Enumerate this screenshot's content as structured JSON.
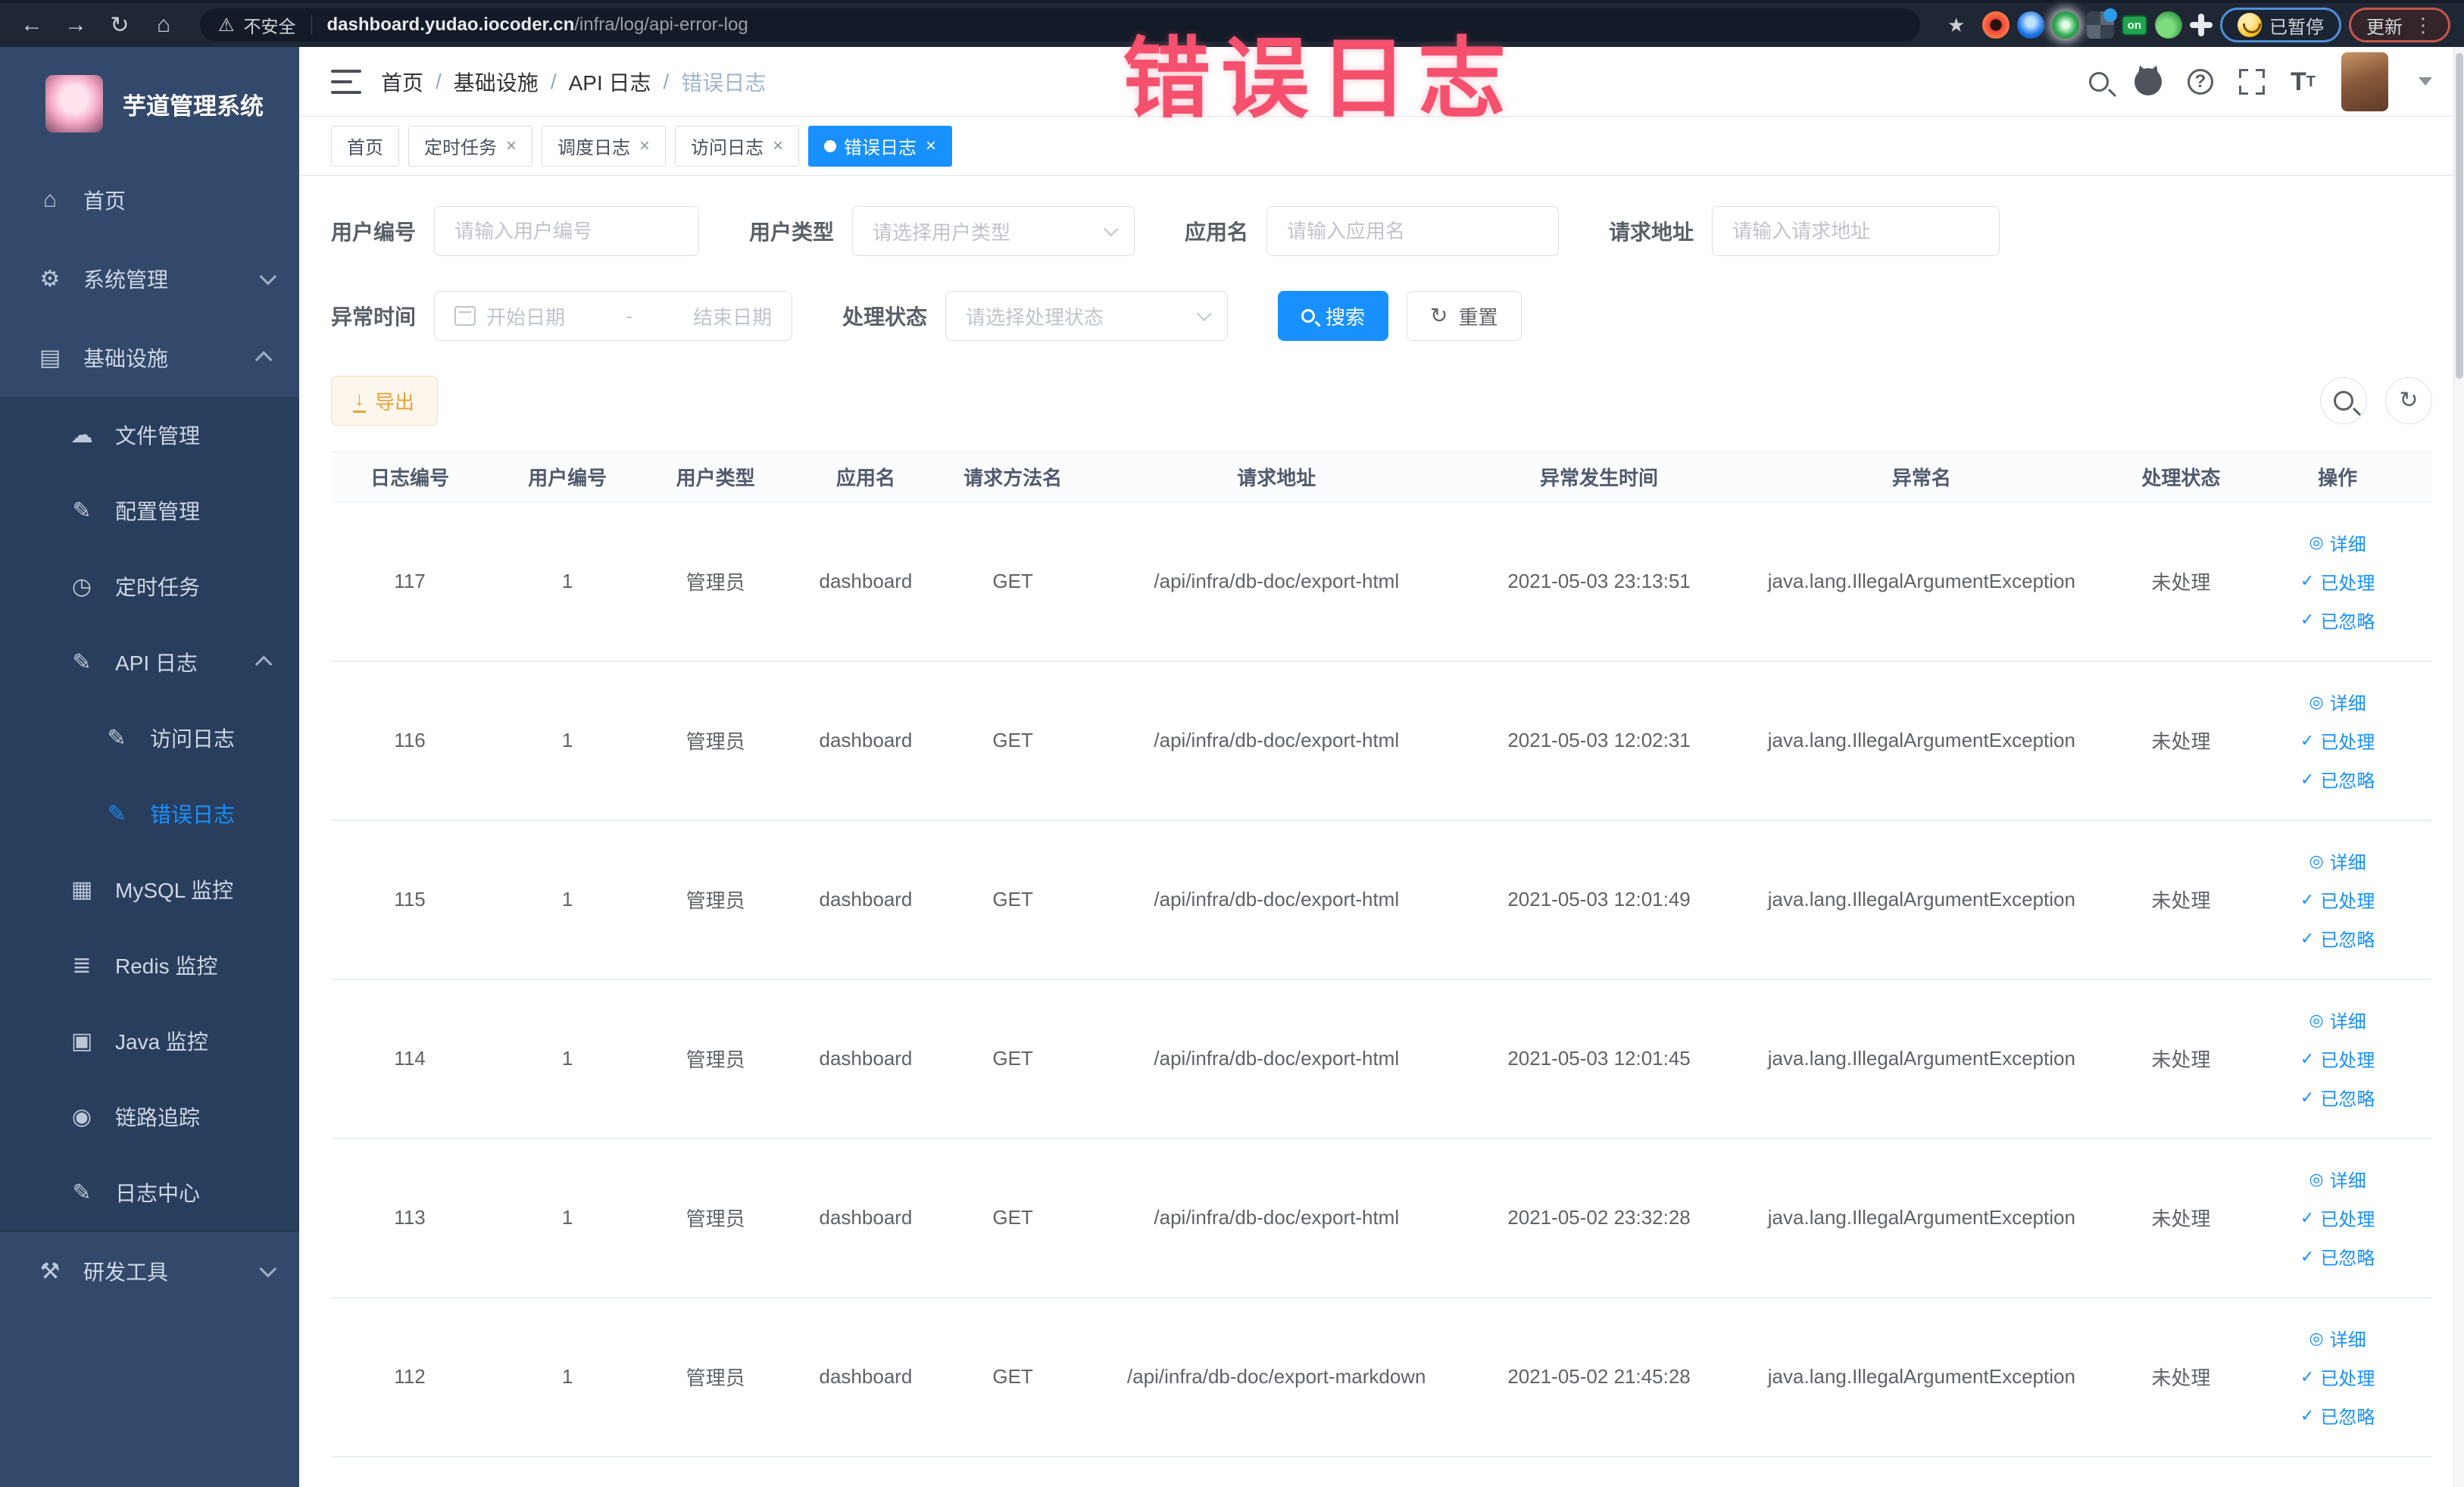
{
  "browser": {
    "security_label": "不安全",
    "url_host": "dashboard.yudao.iocoder.cn",
    "url_path": "/infra/log/api-error-log",
    "on_badge_label": "on",
    "paused_pill_label": "已暂停",
    "update_pill_label": "更新"
  },
  "watermark_text": "错误日志",
  "sidebar": {
    "app_title": "芋道管理系统",
    "items": [
      {
        "id": "home",
        "label": "首页",
        "level": 1,
        "icon": "home-icon"
      },
      {
        "id": "system",
        "label": "系统管理",
        "level": 1,
        "icon": "gear-icon",
        "arrow": "down"
      },
      {
        "id": "infra",
        "label": "基础设施",
        "level": 1,
        "icon": "monitor-icon",
        "arrow": "up"
      },
      {
        "id": "file",
        "label": "文件管理",
        "level": 2,
        "icon": "cloud-icon",
        "sub": true
      },
      {
        "id": "config",
        "label": "配置管理",
        "level": 2,
        "icon": "edit-icon",
        "sub": true
      },
      {
        "id": "job",
        "label": "定时任务",
        "level": 2,
        "icon": "clock-icon",
        "sub": true
      },
      {
        "id": "api-log",
        "label": "API 日志",
        "level": 2,
        "icon": "log-icon",
        "arrow": "up",
        "sub": true
      },
      {
        "id": "access-log",
        "label": "访问日志",
        "level": 3,
        "icon": "log-icon",
        "sub": true
      },
      {
        "id": "error-log",
        "label": "错误日志",
        "level": 3,
        "icon": "log-icon",
        "active": true,
        "sub": true
      },
      {
        "id": "mysql",
        "label": "MySQL 监控",
        "level": 2,
        "icon": "mysql-icon",
        "sub": true
      },
      {
        "id": "redis",
        "label": "Redis 监控",
        "level": 2,
        "icon": "redis-icon",
        "sub": true
      },
      {
        "id": "java",
        "label": "Java 监控",
        "level": 2,
        "icon": "java-icon",
        "sub": true
      },
      {
        "id": "trace",
        "label": "链路追踪",
        "level": 2,
        "icon": "eye-icon",
        "sub": true
      },
      {
        "id": "log-center",
        "label": "日志中心",
        "level": 2,
        "icon": "log-icon",
        "sub": true
      },
      {
        "id": "divider",
        "divider": true
      },
      {
        "id": "dev-tools",
        "label": "研发工具",
        "level": 1,
        "icon": "tools-icon",
        "arrow": "down"
      }
    ]
  },
  "icon_glyphs": {
    "home-icon": "⌂",
    "gear-icon": "⚙",
    "monitor-icon": "▤",
    "cloud-icon": "☁",
    "edit-icon": "✎",
    "clock-icon": "◷",
    "log-icon": "✎",
    "mysql-icon": "▦",
    "redis-icon": "≣",
    "java-icon": "▣",
    "eye-icon": "◉",
    "tools-icon": "⚒",
    "op-eye-icon": "◎",
    "op-check-icon": "✓"
  },
  "header": {
    "breadcrumb": [
      "首页",
      "基础设施",
      "API 日志",
      "错误日志"
    ]
  },
  "tabs": [
    {
      "label": "首页",
      "closable": false,
      "active": false
    },
    {
      "label": "定时任务",
      "closable": true,
      "active": false
    },
    {
      "label": "调度日志",
      "closable": true,
      "active": false
    },
    {
      "label": "访问日志",
      "closable": true,
      "active": false
    },
    {
      "label": "错误日志",
      "closable": true,
      "active": true
    }
  ],
  "filters": {
    "user_id": {
      "label": "用户编号",
      "placeholder": "请输入用户编号"
    },
    "user_type": {
      "label": "用户类型",
      "placeholder": "请选择用户类型"
    },
    "app_name": {
      "label": "应用名",
      "placeholder": "请输入应用名"
    },
    "request_url": {
      "label": "请求地址",
      "placeholder": "请输入请求地址"
    },
    "error_time": {
      "label": "异常时间",
      "start_placeholder": "开始日期",
      "separator": "-",
      "end_placeholder": "结束日期"
    },
    "process_status": {
      "label": "处理状态",
      "placeholder": "请选择处理状态"
    },
    "search_label": "搜索",
    "reset_label": "重置"
  },
  "toolbar": {
    "export_label": "导出"
  },
  "table": {
    "columns": [
      "日志编号",
      "用户编号",
      "用户类型",
      "应用名",
      "请求方法名",
      "请求地址",
      "异常发生时间",
      "异常名",
      "处理状态",
      "操作"
    ],
    "rows": [
      {
        "id": "117",
        "user_id": "1",
        "user_type": "管理员",
        "app": "dashboard",
        "method": "GET",
        "url": "/api/infra/db-doc/export-html",
        "time": "2021-05-03 23:13:51",
        "exception": "java.lang.IllegalArgumentException",
        "status": "未处理"
      },
      {
        "id": "116",
        "user_id": "1",
        "user_type": "管理员",
        "app": "dashboard",
        "method": "GET",
        "url": "/api/infra/db-doc/export-html",
        "time": "2021-05-03 12:02:31",
        "exception": "java.lang.IllegalArgumentException",
        "status": "未处理"
      },
      {
        "id": "115",
        "user_id": "1",
        "user_type": "管理员",
        "app": "dashboard",
        "method": "GET",
        "url": "/api/infra/db-doc/export-html",
        "time": "2021-05-03 12:01:49",
        "exception": "java.lang.IllegalArgumentException",
        "status": "未处理"
      },
      {
        "id": "114",
        "user_id": "1",
        "user_type": "管理员",
        "app": "dashboard",
        "method": "GET",
        "url": "/api/infra/db-doc/export-html",
        "time": "2021-05-03 12:01:45",
        "exception": "java.lang.IllegalArgumentException",
        "status": "未处理"
      },
      {
        "id": "113",
        "user_id": "1",
        "user_type": "管理员",
        "app": "dashboard",
        "method": "GET",
        "url": "/api/infra/db-doc/export-html",
        "time": "2021-05-02 23:32:28",
        "exception": "java.lang.IllegalArgumentException",
        "status": "未处理"
      },
      {
        "id": "112",
        "user_id": "1",
        "user_type": "管理员",
        "app": "dashboard",
        "method": "GET",
        "url": "/api/infra/db-doc/export-markdown",
        "time": "2021-05-02 21:45:28",
        "exception": "java.lang.IllegalArgumentException",
        "status": "未处理"
      }
    ],
    "row_actions": [
      {
        "label": "详细",
        "icon": "op-eye-icon"
      },
      {
        "label": "已处理",
        "icon": "op-check-icon"
      },
      {
        "label": "已忽略",
        "icon": "op-check-icon"
      }
    ]
  },
  "colors": {
    "accent_blue": "#1890ff",
    "sidebar_bg": "#33496b",
    "submenu_bg": "#293e5c",
    "warning_orange": "#e6a23c",
    "watermark_pink": "#f5506e"
  }
}
